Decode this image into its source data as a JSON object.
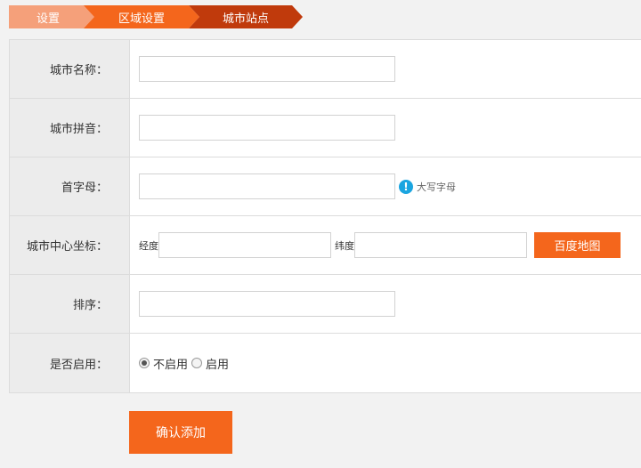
{
  "breadcrumb": {
    "items": [
      {
        "label": "设置",
        "color": "#f5a07a"
      },
      {
        "label": "区域设置",
        "color": "#f4661c"
      },
      {
        "label": "城市站点",
        "color": "#c03a0c"
      }
    ]
  },
  "form": {
    "city_name": {
      "label": "城市名称：",
      "value": ""
    },
    "city_pinyin": {
      "label": "城市拼音：",
      "value": ""
    },
    "initial": {
      "label": "首字母：",
      "value": "",
      "hint": "大写字母",
      "hint_icon": "!"
    },
    "center": {
      "label": "城市中心坐标：",
      "lng_label": "经度",
      "lng_value": "",
      "lat_label": "纬度",
      "lat_value": "",
      "map_button": "百度地图"
    },
    "sort": {
      "label": "排序：",
      "value": ""
    },
    "enabled": {
      "label": "是否启用：",
      "options": [
        {
          "label": "不启用",
          "checked": true
        },
        {
          "label": "启用",
          "checked": false
        }
      ]
    }
  },
  "submit": {
    "label": "确认添加"
  },
  "colors": {
    "accent": "#f4661c",
    "info": "#1ba5e0"
  }
}
